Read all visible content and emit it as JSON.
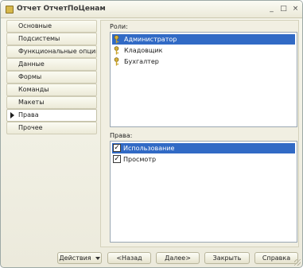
{
  "window": {
    "title": "Отчет ОтчетПоЦенам",
    "controls": {
      "minimize": "_",
      "maximize": "□",
      "close": "×"
    }
  },
  "sidebar": {
    "items": [
      {
        "label": "Основные",
        "active": false
      },
      {
        "label": "Подсистемы",
        "active": false
      },
      {
        "label": "Функциональные опции",
        "active": false
      },
      {
        "label": "Данные",
        "active": false
      },
      {
        "label": "Формы",
        "active": false
      },
      {
        "label": "Команды",
        "active": false
      },
      {
        "label": "Макеты",
        "active": false
      },
      {
        "label": "Права",
        "active": true
      },
      {
        "label": "Прочее",
        "active": false
      }
    ]
  },
  "roles": {
    "label": "Роли:",
    "items": [
      {
        "label": "Администратор",
        "selected": true,
        "icon": "key-icon"
      },
      {
        "label": "Кладовщик",
        "selected": false,
        "icon": "key-icon"
      },
      {
        "label": "Бухгалтер",
        "selected": false,
        "icon": "key-icon"
      }
    ]
  },
  "rights": {
    "label": "Права:",
    "items": [
      {
        "label": "Использование",
        "checked": true,
        "selected": true
      },
      {
        "label": "Просмотр",
        "checked": true,
        "selected": false
      }
    ]
  },
  "footer": {
    "actions": "Действия",
    "back": "<Назад",
    "next": "Далее>",
    "close": "Закрыть",
    "help": "Справка"
  },
  "colors": {
    "selection": "#316ac5",
    "window_bg": "#eceadc",
    "key_gold": "#c9a227"
  }
}
